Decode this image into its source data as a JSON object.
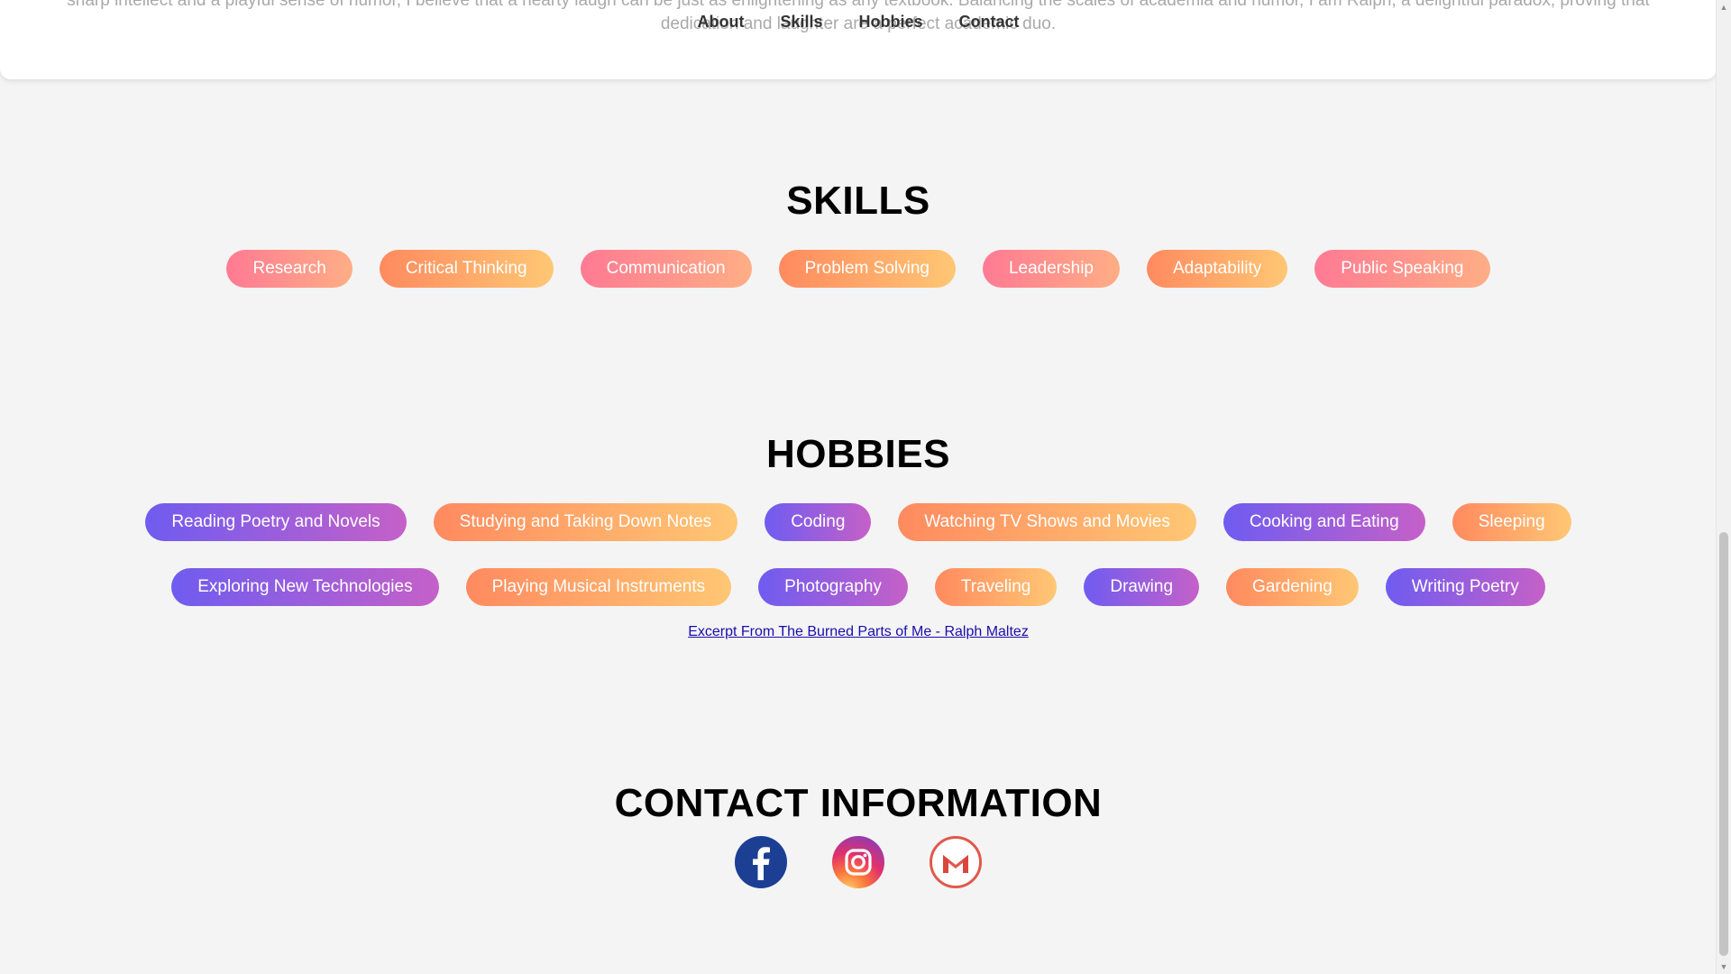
{
  "about": {
    "text_line1": "sharp intellect and a playful sense of humor, I believe that a hearty laugh can be just as enlightening as any textbook. Balancing the scales of academia and humor, I am Ralph, a delightful paradox, proving that",
    "text_line2": "dedication and laughter are a perfect academic duo."
  },
  "nav": {
    "items": [
      "About",
      "Skills",
      "Hobbies",
      "Contact"
    ]
  },
  "skills": {
    "title": "SKILLS",
    "items": [
      {
        "label": "Research",
        "style": "pink"
      },
      {
        "label": "Critical Thinking",
        "style": "orange"
      },
      {
        "label": "Communication",
        "style": "pink"
      },
      {
        "label": "Problem Solving",
        "style": "orange"
      },
      {
        "label": "Leadership",
        "style": "pink"
      },
      {
        "label": "Adaptability",
        "style": "orange"
      },
      {
        "label": "Public Speaking",
        "style": "pink"
      }
    ]
  },
  "hobbies": {
    "title": "HOBBIES",
    "row1": [
      {
        "label": "Reading Poetry and Novels",
        "style": "purple"
      },
      {
        "label": "Studying and Taking Down Notes",
        "style": "orange"
      },
      {
        "label": "Coding",
        "style": "purple"
      },
      {
        "label": "Watching TV Shows and Movies",
        "style": "orange"
      },
      {
        "label": "Cooking and Eating",
        "style": "purple"
      },
      {
        "label": "Sleeping",
        "style": "orange"
      }
    ],
    "row2": [
      {
        "label": "Exploring New Technologies",
        "style": "purple"
      },
      {
        "label": "Playing Musical Instruments",
        "style": "orange"
      },
      {
        "label": "Photography",
        "style": "purple"
      },
      {
        "label": "Traveling",
        "style": "orange"
      },
      {
        "label": "Drawing",
        "style": "purple"
      },
      {
        "label": "Gardening",
        "style": "orange"
      },
      {
        "label": "Writing Poetry",
        "style": "purple"
      }
    ],
    "excerpt_link": "Excerpt From The Burned Parts of Me - Ralph Maltez"
  },
  "contact": {
    "title": "CONTACT INFORMATION",
    "icons": [
      "facebook-icon",
      "instagram-icon",
      "gmail-icon"
    ]
  },
  "colors": {
    "background": "#f4f4f4",
    "pink_gradient": [
      "#ff7a93",
      "#ffae85"
    ],
    "orange_gradient": [
      "#ff8a5f",
      "#ffc774"
    ],
    "purple_gradient": [
      "#6f5cf0",
      "#c560c8"
    ],
    "link": "#1a0dab",
    "facebook": "#1c3f94"
  }
}
